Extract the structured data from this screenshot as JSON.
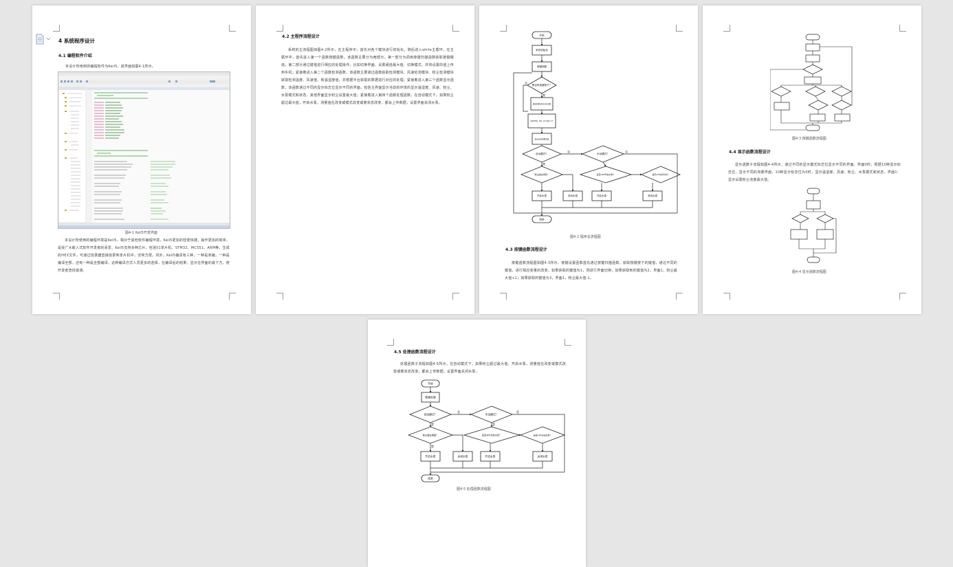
{
  "pages": {
    "p1": {
      "chapter_title": "4 系统程序设计",
      "section_title": "4.1 编程软件介绍",
      "intro_text": "本设计所用到的编程软件为Keil5，其界面如图4-1所示。",
      "figure_caption": "图4-1 Keil5开发界面",
      "body_text": "本设计所使用的编程环境是Keil5，相对于其他软件编程环境，Keil5更加的轻便快捷，操作更加的简单，是受广大嵌入式软件开发者的喜爱。Keil5支持多种芯片，包括51单片机、STM32、MCS51、ARM等，生成的HEX文件，可通过烧录器直接烧录到单片机中，非常方便。另外，Keil5编译有三种，一种是单编，一种是编译全部，还有一种是全部编译，这种编译方式人员更多的选择，在编译后的结果，显示在界面的最下方，使开发者查找错误。"
    },
    "p2": {
      "section_title": "4.2 主程序流程设计",
      "body_text": "系统的主流程图如图4-2所示，在主程序中，首先对各个模块进行初始化，随后进入while主循环，在主循环中，首先进入第一个函数按键函数，该函数主要分为两部分，第一部分为调用按键扫描函数获取按键键值，第二部分通过键值进行相应的处理操作，比如切换界面、设置阈值最大值、切换模式，并将设置的值上传到手机；紧接着进入第二个函数检测函数，该函数主要通过函数获取检测模块、风速检测模块、粉尘检测模块获取检测温度、风速值、和温湿度值，并根据平台获取的数据进行对应的处理；紧接着进入第三个函数显示函数，该函数通过不同的显示标志位显示不同的界面，包括主界面显示当前的环境的显示温湿度、风速、粉尘、水泵模式和状态，其他界面显示粉尘设置最大值；紧接着进入第四个函数处理函数，在自动模式下，如果粉尘超过最大值，开启水泵，测量值在改变或模式改变或着状态改变，都会上传数据，设置界面关闭水泵。"
    },
    "p3": {
      "figure_caption": "图4-2 程序总流程图",
      "section_title": "4.3 按键函数流程设计",
      "body_text": "按键函数流程图如图4-3所示，按键设置函数首先通过按键扫描函数，获取按键按下的键值，通过不同的键值，进行相应变量的改变，如果获取的键值为1，则进行界面切换，如果获取到的键值为2，界面1，粉尘最大值+1；如果获取的键值为3，界面1，粉尘最大值-1。",
      "flow_labels": {
        "start": "开始",
        "init": "系统初始化",
        "key_func": "按键函数",
        "decision_key": "是否有按键按下？",
        "process": "根据按键值修改对应变量",
        "collect": "采集温湿度、风速、粉尘浓度并上传",
        "display": "显示对应界面内容",
        "d_auto": "自动模式？",
        "d_manual": "手动模式？",
        "d_dust": "粉尘超过阈值？",
        "d_app1": "是否APP开启水泵？",
        "d_app2": "是否APP关闭水泵？",
        "pump_on": "开启水泵",
        "pump_off": "关闭水泵",
        "pump_on2": "开启水泵",
        "pump_off2": "关闭水泵",
        "end": "结束",
        "yes": "是",
        "no": "否"
      }
    },
    "p4": {
      "figure_caption_1": "图4-3 按键函数流程图",
      "section_title": "4.4 显示函数流程设计",
      "body_text": "显示函数子流程如图4-4所示，通过不同的显示模式标志位显示不同的界面，界面0时，根据10种显示标志位，显示不同的测量界面，10种显示标志位为0时，显示温湿度、风速、粉尘、水泵模式和状态，界面1：显示设置粉尘浓度最大值。",
      "figure_caption_2": "图4-4 显示函数流程图"
    },
    "p5": {
      "section_title": "4.5 处理函数流程设计",
      "body_text": "处理函数子流程如图4-5所示，在自动模式下，如果粉尘超过最大值，开启水泵，测量值在改变或模式改变或着状态改变，都会上传数据，设置界面关闭水泵。",
      "figure_caption": "图4-5 处理函数流程图",
      "flow_labels": {
        "start": "开始",
        "init": "数据处理",
        "d_auto": "自动模式？",
        "d_manual": "手动模式？",
        "d_dust": "粉尘超过阈值？",
        "d_app1": "是否APP开启水泵？",
        "d_app2": "是否APP关闭水泵？",
        "pump_on": "开启水泵",
        "pump_off": "关闭水泵",
        "pump_on2": "开启水泵",
        "pump_off2": "关闭水泵",
        "end": "结束",
        "yes": "是",
        "no": "否"
      }
    }
  }
}
